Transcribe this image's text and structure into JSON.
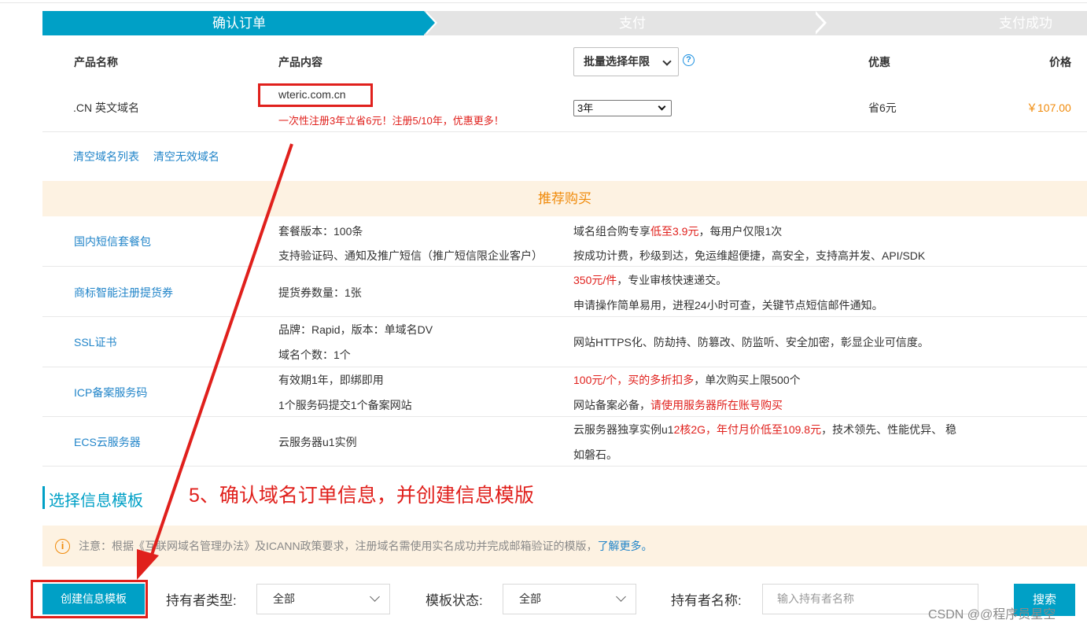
{
  "steps": [
    "确认订单",
    "支付",
    "支付成功"
  ],
  "table_head": {
    "name": "产品名称",
    "content": "产品内容",
    "batch_select": "批量选择年限",
    "discount": "优惠",
    "price": "价格"
  },
  "product": {
    "name": ".CN 英文域名",
    "domain": "wteric.com.cn",
    "promo": "一次性注册3年立省6元！注册5/10年，优惠更多！",
    "years": "3年",
    "discount": "省6元",
    "price": "￥107.00"
  },
  "clear_links": [
    "清空域名列表",
    "清空无效域名"
  ],
  "recommend": {
    "title": "推荐购买",
    "items": [
      {
        "name": "国内短信套餐包",
        "c1": "套餐版本：100条",
        "c2": "支持验证码、通知及推广短信（推广短信限企业客户）",
        "d1a": "域名组合购专享",
        "d1b": "低至3.9元",
        "d1c": "，每用户仅限1次",
        "d2": "按成功计费，秒级到达，免运维超便捷，高安全，支持高并发、API/SDK"
      },
      {
        "name": "商标智能注册提货券",
        "c1": "提货券数量：1张",
        "d1a": "350元/件",
        "d1b": "，专业审核快速递交。",
        "d2": "申请操作简单易用，进程24小时可查，关键节点短信邮件通知。"
      },
      {
        "name": "SSL证书",
        "c1": "品牌：Rapid，版本：单域名DV",
        "c2": "域名个数：1个",
        "d1": "网站HTTPS化、防劫持、防篡改、防监听、安全加密，彰显企业可信度。"
      },
      {
        "name": "ICP备案服务码",
        "c1": "有效期1年，即绑即用",
        "c2": "1个服务码提交1个备案网站",
        "d1a": "100元/个，买的多折扣多",
        "d1b": "，单次购买上限500个",
        "d2a": "网站备案必备，",
        "d2b": "请使用服务器所在账号购买"
      },
      {
        "name": "ECS云服务器",
        "c1": "云服务器u1实例",
        "d1a": "云服务器独享实例u1",
        "d1b": "2核2G，年付月价低至109.8元",
        "d1c": "，技术领先、性能优异、 稳",
        "d2": "如磐石。"
      }
    ]
  },
  "section_title": "选择信息模板",
  "annotation": "5、确认域名订单信息，并创建信息模版",
  "notice": {
    "text": "注意：根据《互联网域名管理办法》及ICANN政策要求，注册域名需使用实名成功并完成邮箱验证的模版，",
    "link": "了解更多。"
  },
  "filters": {
    "create_button": "创建信息模板",
    "holder_type_label": "持有者类型:",
    "holder_type_value": "全部",
    "status_label": "模板状态:",
    "status_value": "全部",
    "holder_name_label": "持有者名称:",
    "holder_name_placeholder": "输入持有者名称",
    "search_button": "搜索"
  },
  "watermark": "CSDN @@程序员星空",
  "colors": {
    "accent": "#00a0c6",
    "annotation_red": "#e0201c",
    "price_orange": "#f08a0a",
    "link_blue": "#2285c9"
  }
}
